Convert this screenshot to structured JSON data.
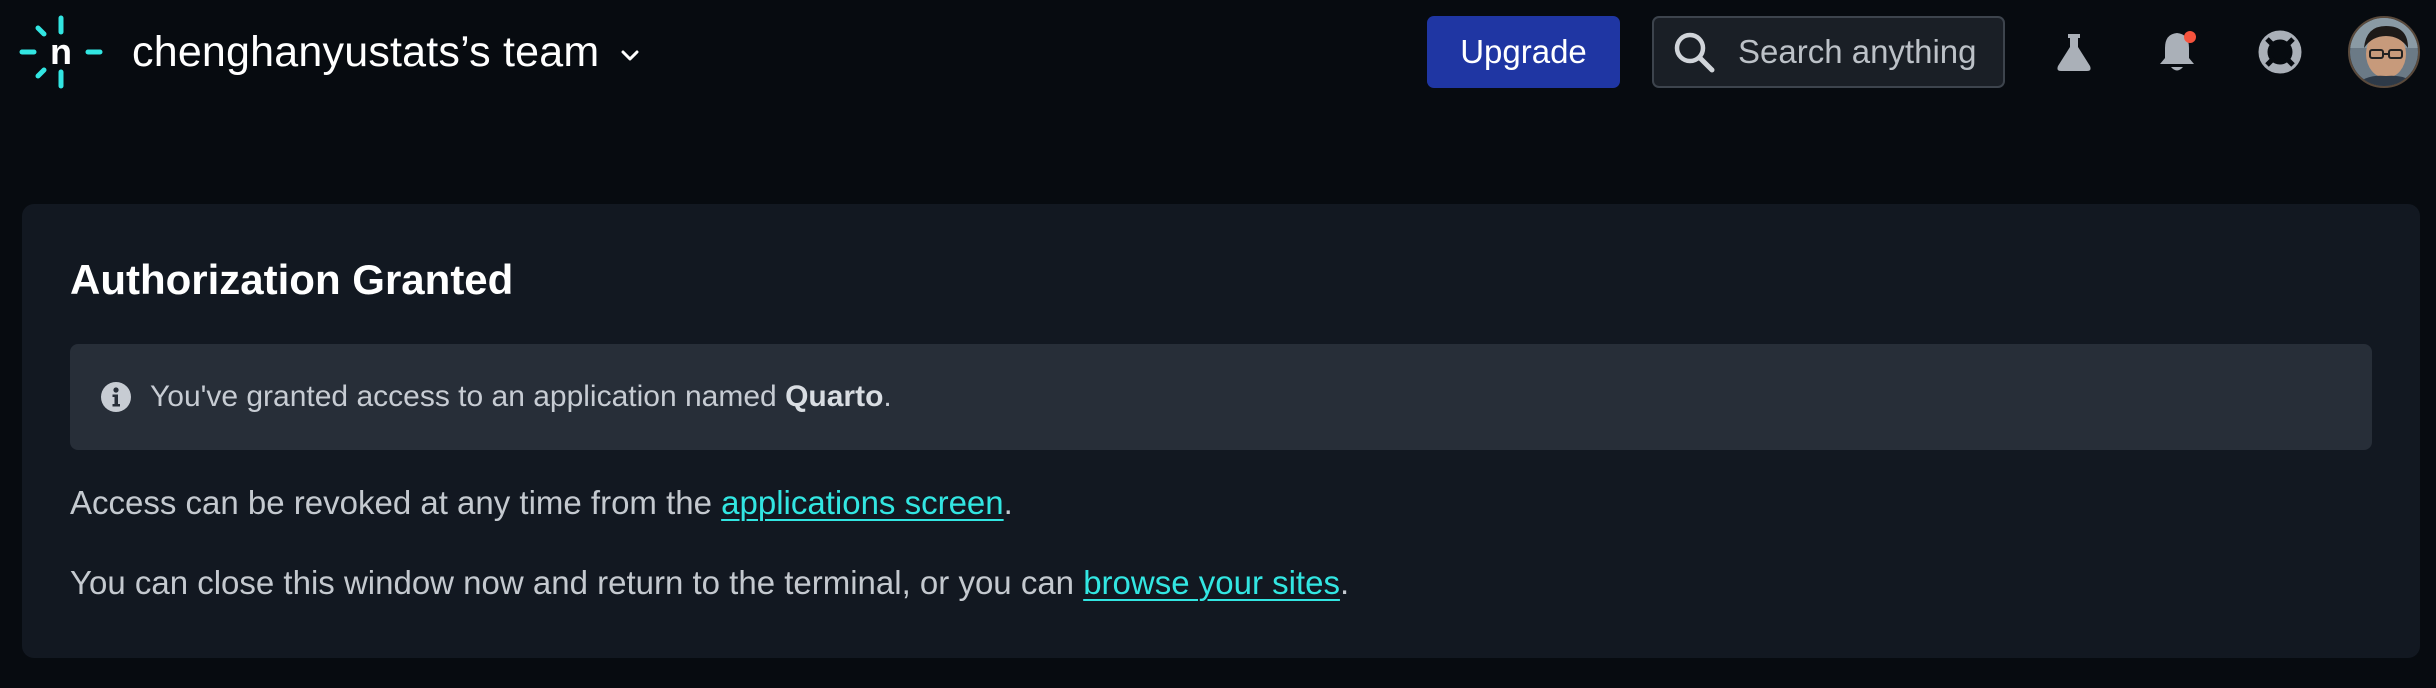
{
  "header": {
    "logo_icon": "netlify-logo-icon",
    "team_name": "chenghanyustats’s team",
    "team_switch_icon": "chevron-down-icon",
    "upgrade_label": "Upgrade",
    "search": {
      "placeholder": "Search anything",
      "icon": "search-icon"
    },
    "icons": [
      "flask-icon",
      "bell-icon",
      "help-lifebuoy-icon"
    ],
    "notification_dot_color": "#f5533d",
    "avatar_alt": "avatar"
  },
  "card": {
    "title": "Authorization Granted",
    "notice": {
      "icon": "info-icon",
      "text_before": "You've granted access to an application named ",
      "app_name": "Quarto",
      "text_after": "."
    },
    "revoke": {
      "text_before": "Access can be revoked at any time from the ",
      "link": "applications screen",
      "text_after": "."
    },
    "close": {
      "text_before": "You can close this window now and return to the terminal, or you can ",
      "link": "browse your sites",
      "text_after": "."
    }
  },
  "colors": {
    "background": "#070b10",
    "card": "#121821",
    "notice": "#272e38",
    "accent_link": "#32e6e2",
    "upgrade_button": "#1f36a3",
    "logo_teal": "#32e6e2"
  }
}
